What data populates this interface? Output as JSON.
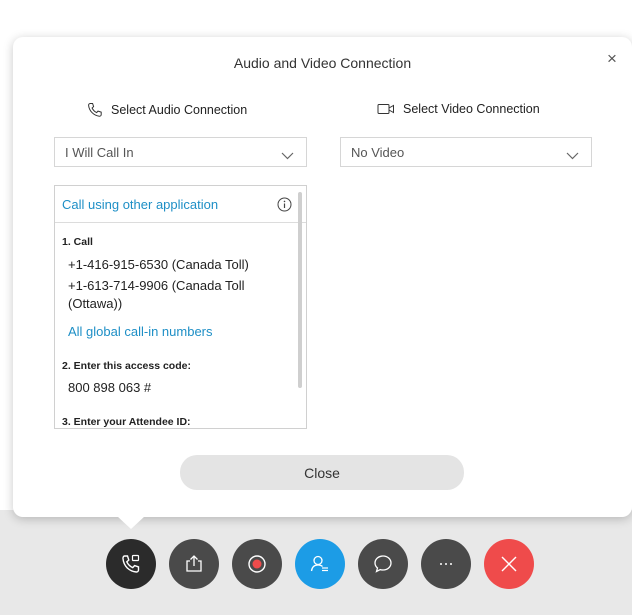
{
  "dialog": {
    "title": "Audio and Video Connection",
    "close_symbol": "×"
  },
  "audio": {
    "header": "Select Audio Connection",
    "icon": "phone-icon",
    "selected": "I Will Call In"
  },
  "video": {
    "header": "Select Video Connection",
    "icon": "video-camera-icon",
    "selected": "No Video"
  },
  "call_panel": {
    "link": "Call using other application",
    "step1": "1. Call",
    "numbers": [
      "+1-416-915-6530 (Canada Toll)",
      "+1-613-714-9906 (Canada Toll (Ottawa))"
    ],
    "global_link": "All global call-in numbers",
    "step2": "2. Enter this access code:",
    "access_code": "800 898 063 #",
    "step3": "3. Enter your Attendee ID:"
  },
  "buttons": {
    "close": "Close"
  },
  "controls": [
    {
      "icon": "audio-connection-icon",
      "color": "#2b2b2b"
    },
    {
      "icon": "share-icon",
      "color": "#4a4a4a"
    },
    {
      "icon": "record-icon",
      "color": "#4a4a4a"
    },
    {
      "icon": "participants-icon",
      "color": "#1c9ce6"
    },
    {
      "icon": "chat-icon",
      "color": "#4a4a4a"
    },
    {
      "icon": "more-icon",
      "color": "#4a4a4a"
    },
    {
      "icon": "end-meeting-icon",
      "color": "#ef4b4b"
    }
  ],
  "colors": {
    "link": "#1e8fc6",
    "accent": "#1c9ce6",
    "end": "#ef4b4b"
  }
}
